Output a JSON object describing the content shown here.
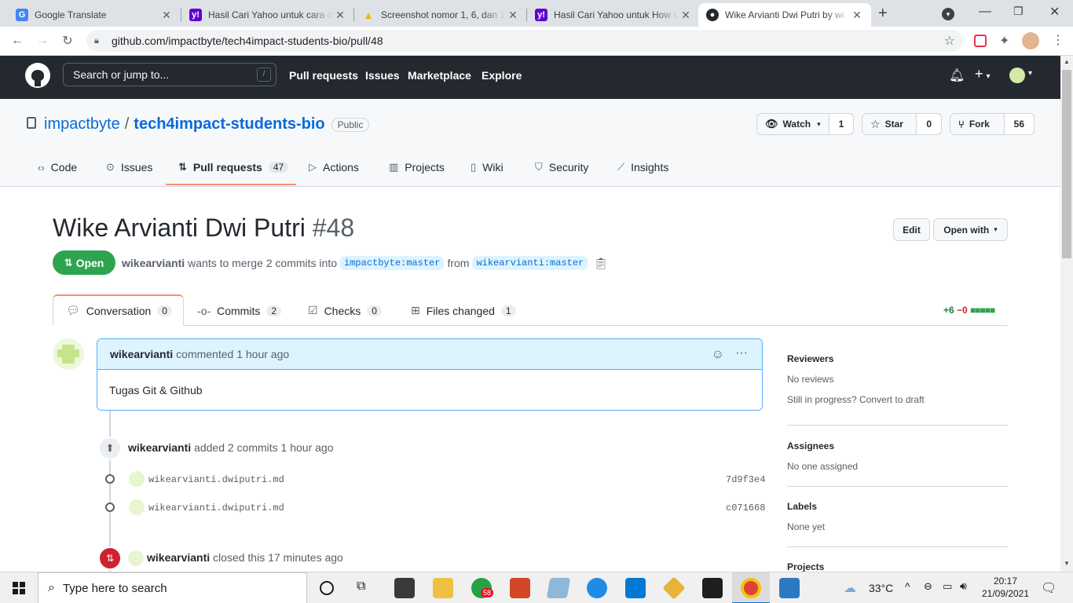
{
  "browser": {
    "tabs": [
      {
        "title": "Google Translate",
        "fav": "G",
        "color": "#4285f4"
      },
      {
        "title": "Hasil Cari Yahoo untuk cara cl",
        "fav": "y!",
        "color": "#6001d2"
      },
      {
        "title": "Screenshot nomor 1, 6, dan 1",
        "fav": "▲",
        "color": "#f4b400"
      },
      {
        "title": "Hasil Cari Yahoo untuk How c",
        "fav": "y!",
        "color": "#6001d2"
      },
      {
        "title": "Wike Arvianti Dwi Putri by wi",
        "fav": "●",
        "color": "#24292f"
      }
    ],
    "url": "github.com/impactbyte/tech4impact-students-bio/pull/48"
  },
  "gh": {
    "search_placeholder": "Search or jump to...",
    "slash": "/",
    "nav": [
      "Pull requests",
      "Issues",
      "Marketplace",
      "Explore"
    ]
  },
  "repo": {
    "owner": "impactbyte",
    "sep": "/",
    "name": "tech4impact-students-bio",
    "visibility": "Public",
    "watch": {
      "label": "Watch",
      "count": "1"
    },
    "star": {
      "label": "Star",
      "count": "0"
    },
    "fork": {
      "label": "Fork",
      "count": "56"
    },
    "tabs": [
      {
        "label": "Code",
        "icon": "‹›"
      },
      {
        "label": "Issues",
        "icon": "⊙"
      },
      {
        "label": "Pull requests",
        "icon": "⇅",
        "count": "47"
      },
      {
        "label": "Actions",
        "icon": "▷"
      },
      {
        "label": "Projects",
        "icon": "▥"
      },
      {
        "label": "Wiki",
        "icon": "▯"
      },
      {
        "label": "Security",
        "icon": "⛉"
      },
      {
        "label": "Insights",
        "icon": "⟋"
      }
    ]
  },
  "pr": {
    "title": "Wike Arvianti Dwi Putri",
    "number": "#48",
    "edit": "Edit",
    "open_with": "Open with",
    "state": "Open",
    "author": "wikearvianti",
    "merge_text": "wants to merge 2 commits into",
    "base": "impactbyte:master",
    "from": "from",
    "head": "wikearvianti:master",
    "tabs": [
      {
        "label": "Conversation",
        "count": "0"
      },
      {
        "label": "Commits",
        "count": "2"
      },
      {
        "label": "Checks",
        "count": "0"
      },
      {
        "label": "Files changed",
        "count": "1"
      }
    ],
    "diffstat_add": "+6",
    "diffstat_del": "−0",
    "diffstat_blocks": "■■■■■"
  },
  "comment": {
    "author": "wikearvianti",
    "meta": "commented 1 hour ago",
    "body": "Tugas Git & Github"
  },
  "events": {
    "commits_author": "wikearvianti",
    "commits_text": "added 2 commits 1 hour ago",
    "commits": [
      {
        "msg": "wikearvianti.dwiputri.md",
        "sha": "7d9f3e4"
      },
      {
        "msg": "wikearvianti.dwiputri.md",
        "sha": "c071668"
      }
    ],
    "closed_author": "wikearvianti",
    "closed_text": "closed this 17 minutes ago"
  },
  "sidebar": {
    "reviewers_h": "Reviewers",
    "reviewers_t": "No reviews",
    "draft_t": "Still in progress? Convert to draft",
    "assignees_h": "Assignees",
    "assignees_t": "No one assigned",
    "labels_h": "Labels",
    "labels_t": "None yet",
    "projects_h": "Projects"
  },
  "taskbar": {
    "search": "Type here to search",
    "weather": "33°C",
    "time": "20:17",
    "date": "21/09/2021",
    "whatsapp_badge": "58"
  }
}
